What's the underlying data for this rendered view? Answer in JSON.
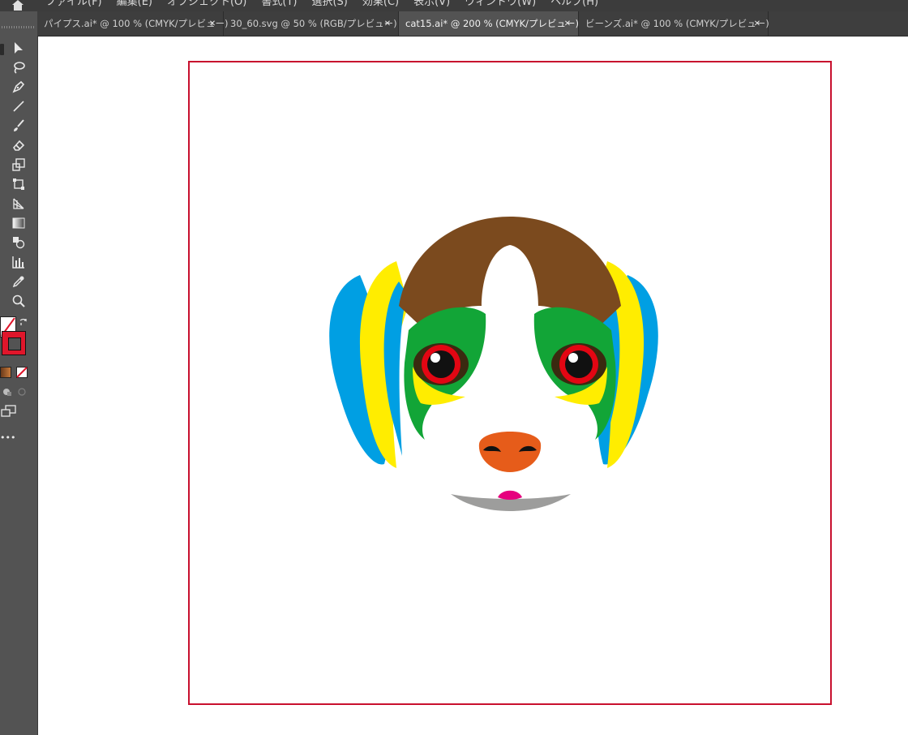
{
  "menubar": {
    "items": [
      "ファイル(F)",
      "編集(E)",
      "オブジェクト(O)",
      "書式(T)",
      "選択(S)",
      "効果(C)",
      "表示(V)",
      "ウィンドウ(W)",
      "ヘルプ(H)"
    ]
  },
  "tabs": [
    {
      "label": "パイプス.ai* @ 100 % (CMYK/プレビュー)",
      "active": false
    },
    {
      "label": "30_60.svg @ 50 % (RGB/プレビュー)",
      "active": false
    },
    {
      "label": "cat15.ai* @ 200 % (CMYK/プレビュー)",
      "active": true
    },
    {
      "label": "ビーンズ.ai* @ 100 % (CMYK/プレビュー)",
      "active": false
    }
  ],
  "toolbar": {
    "tools": [
      "selection-tool",
      "lasso-tool",
      "pen-tool",
      "line-tool",
      "paintbrush-tool",
      "eraser-tool",
      "scale-tool",
      "free-transform-tool",
      "perspective-grid-tool",
      "gradient-tool",
      "shape-builder-tool",
      "graph-tool",
      "eyedropper-tool",
      "zoom-tool"
    ],
    "fill_color": "#ffffff",
    "stroke_color": "#e0162b",
    "more_tools": "•••"
  },
  "colors": {
    "artboard_border": "#c8102e",
    "ear_blue": "#009fe3",
    "ear_yellow": "#ffed00",
    "fur_brown": "#7b4a1e",
    "mask_green": "#12a537",
    "eye_red": "#e30613",
    "nose_orange": "#e65c1a",
    "tongue_pink": "#e6007e",
    "chin_gray": "#9d9d9c"
  }
}
